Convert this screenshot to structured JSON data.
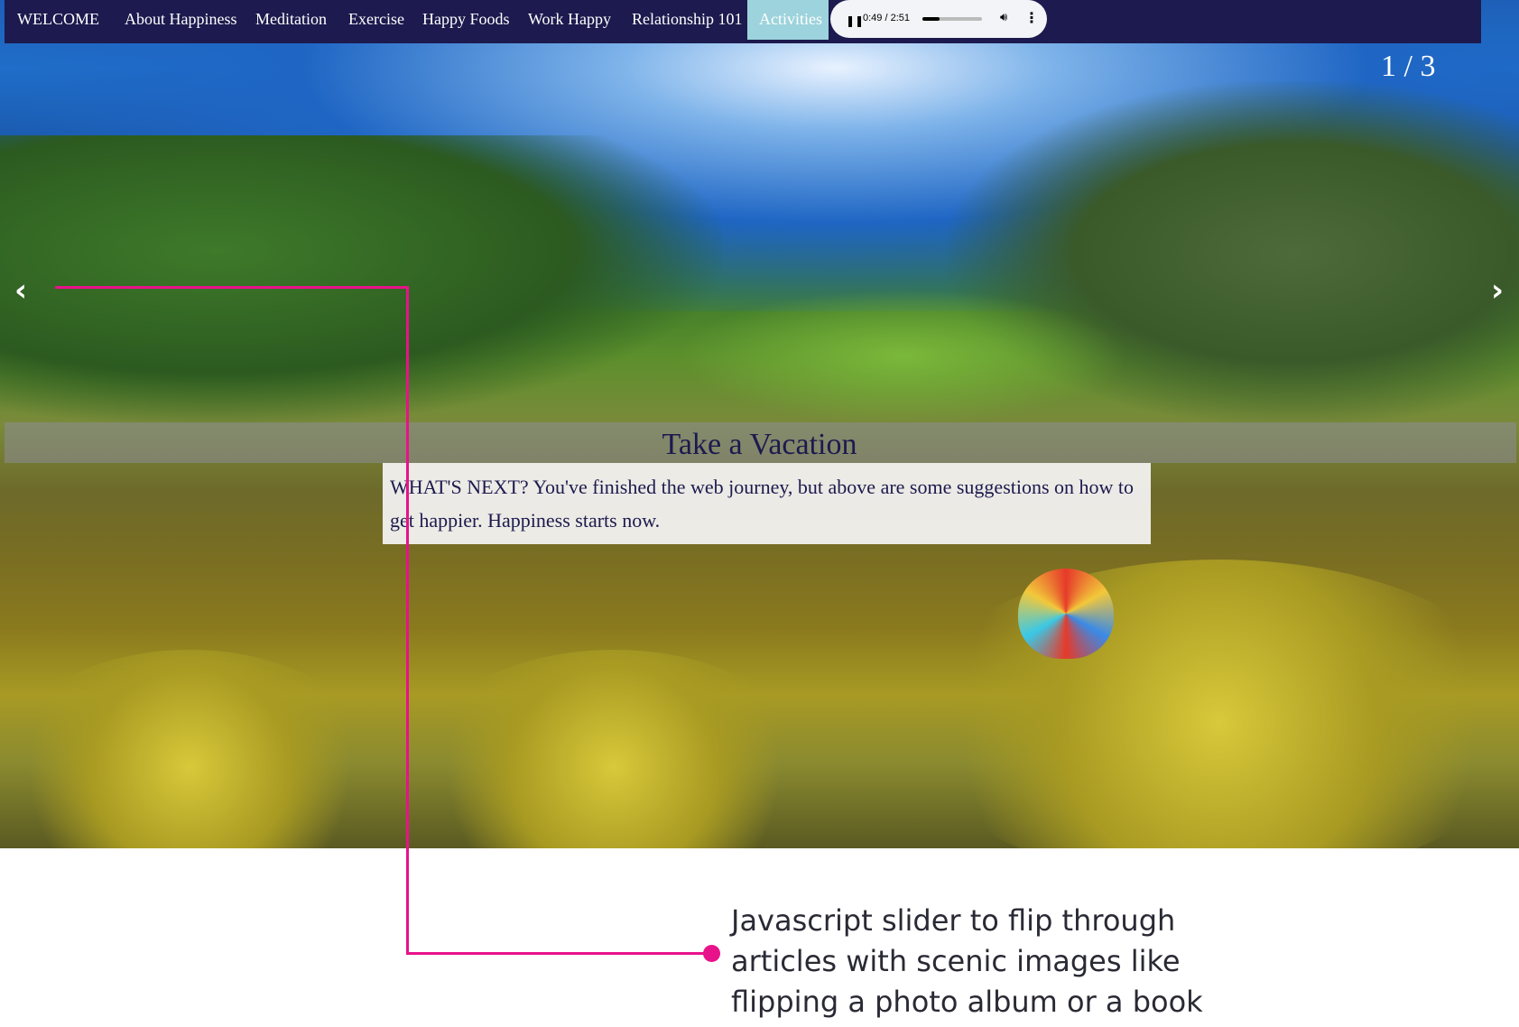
{
  "nav": {
    "items": [
      "WELCOME",
      "About Happiness",
      "Meditation",
      "Exercise",
      "Happy Foods",
      "Work Happy",
      "Relationship 101"
    ],
    "active": "Activities"
  },
  "player": {
    "time": "0:49 / 2:51",
    "progress": 0.29,
    "pause_icon": "pause-icon",
    "volume_icon": "volume-icon",
    "more_icon": "more-vertical-icon"
  },
  "slider": {
    "counter": "1 / 3",
    "prev": "‹",
    "next": "›",
    "title": "Take a Vacation",
    "text": "WHAT'S NEXT? You've finished the web journey, but above are some suggestions on how to get happier. Happiness starts now."
  },
  "annotation": "Javascript slider to flip through articles with scenic images like flipping a photo album or a book",
  "colors": {
    "nav": "#1c1a4e",
    "active": "#9dd3dc",
    "annotation_line": "#e8128a"
  }
}
